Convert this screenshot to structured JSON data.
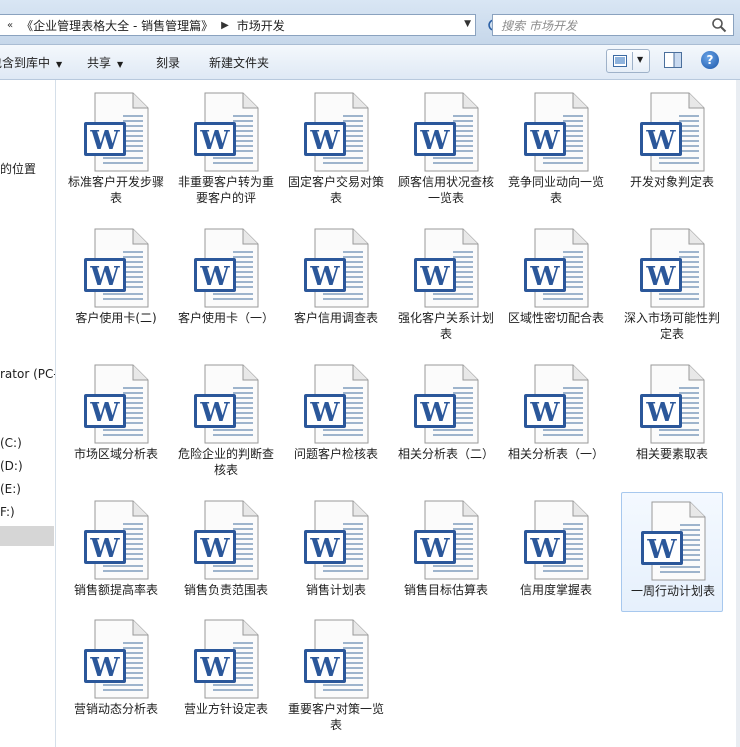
{
  "address": {
    "crumbs": [
      "《企业管理表格大全 - 销售管理篇》",
      "市场开发"
    ],
    "search_placeholder": "搜索 市场开发"
  },
  "toolbar": {
    "include_library": "包含到库中",
    "share": "共享",
    "burn": "刻录",
    "new_folder": "新建文件夹"
  },
  "nav": {
    "items": [
      "的位置",
      "rator (PC-",
      "(C:)",
      "(D:)",
      "(E:)",
      "F:)"
    ]
  },
  "files": [
    {
      "label": "标准客户开发步骤表"
    },
    {
      "label": "非重要客户转为重要客户的评"
    },
    {
      "label": "固定客户交易对策表"
    },
    {
      "label": "顾客信用状况查核一览表"
    },
    {
      "label": "竞争同业动向一览表"
    },
    {
      "label": "开发对象判定表"
    },
    {
      "label": "客户使用卡(二)"
    },
    {
      "label": "客户使用卡（一）"
    },
    {
      "label": "客户信用调查表"
    },
    {
      "label": "强化客户关系计划表"
    },
    {
      "label": "区域性密切配合表"
    },
    {
      "label": "深入市场可能性判定表"
    },
    {
      "label": "市场区域分析表"
    },
    {
      "label": "危险企业的判断查核表"
    },
    {
      "label": "问题客户检核表"
    },
    {
      "label": "相关分析表（二）"
    },
    {
      "label": "相关分析表（一）"
    },
    {
      "label": "相关要素取表"
    },
    {
      "label": "销售额提高率表"
    },
    {
      "label": "销售负责范围表"
    },
    {
      "label": "销售计划表"
    },
    {
      "label": "销售目标估算表"
    },
    {
      "label": "信用度掌握表"
    },
    {
      "label": "一周行动计划表",
      "selected": true
    },
    {
      "label": "营销动态分析表"
    },
    {
      "label": "营业方针设定表"
    },
    {
      "label": "重要客户对策一览表"
    }
  ],
  "colors": {
    "word_blue": "#2b579a",
    "selection": "#a7c8ee"
  }
}
